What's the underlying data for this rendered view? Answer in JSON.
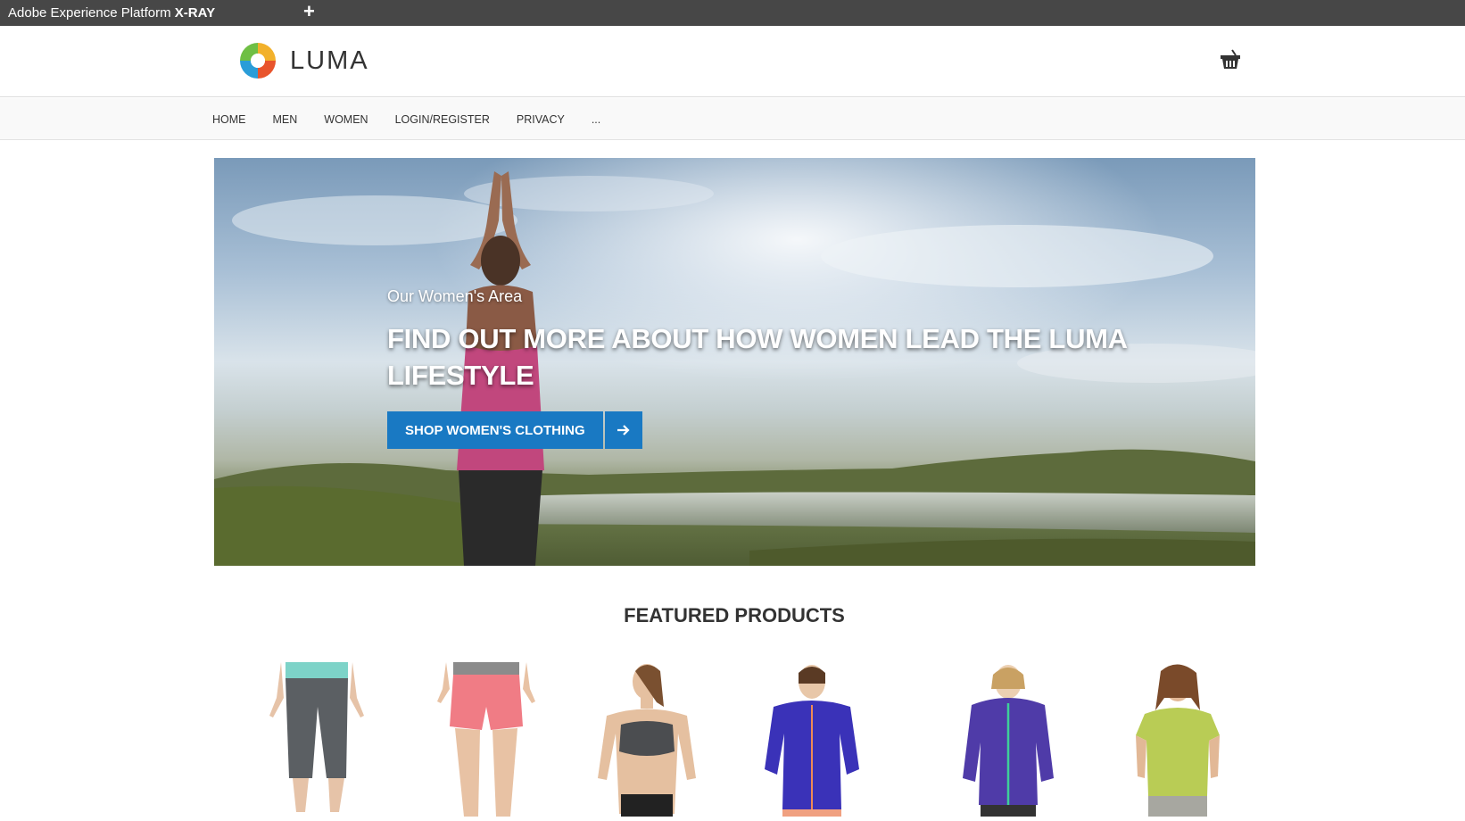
{
  "xray": {
    "title_prefix": "Adobe Experience Platform ",
    "title_bold": "X-RAY",
    "add_label": "+"
  },
  "header": {
    "logo_text": "LUMA",
    "cart_icon": "basket-icon"
  },
  "nav": {
    "items": [
      {
        "label": "HOME"
      },
      {
        "label": "MEN"
      },
      {
        "label": "WOMEN"
      },
      {
        "label": "LOGIN/REGISTER"
      },
      {
        "label": "PRIVACY"
      },
      {
        "label": "..."
      }
    ]
  },
  "hero": {
    "subtitle": "Our Women's Area",
    "headline": "FIND OUT MORE ABOUT HOW WOMEN LEAD THE LUMA LIFESTYLE",
    "cta_label": "SHOP WOMEN'S CLOTHING",
    "cta_icon": "arrow-right-icon"
  },
  "featured": {
    "title": "FEATURED PRODUCTS"
  },
  "colors": {
    "xray_bar": "#474747",
    "accent": "#1979c3",
    "nav_bg": "#f9f9f9"
  }
}
